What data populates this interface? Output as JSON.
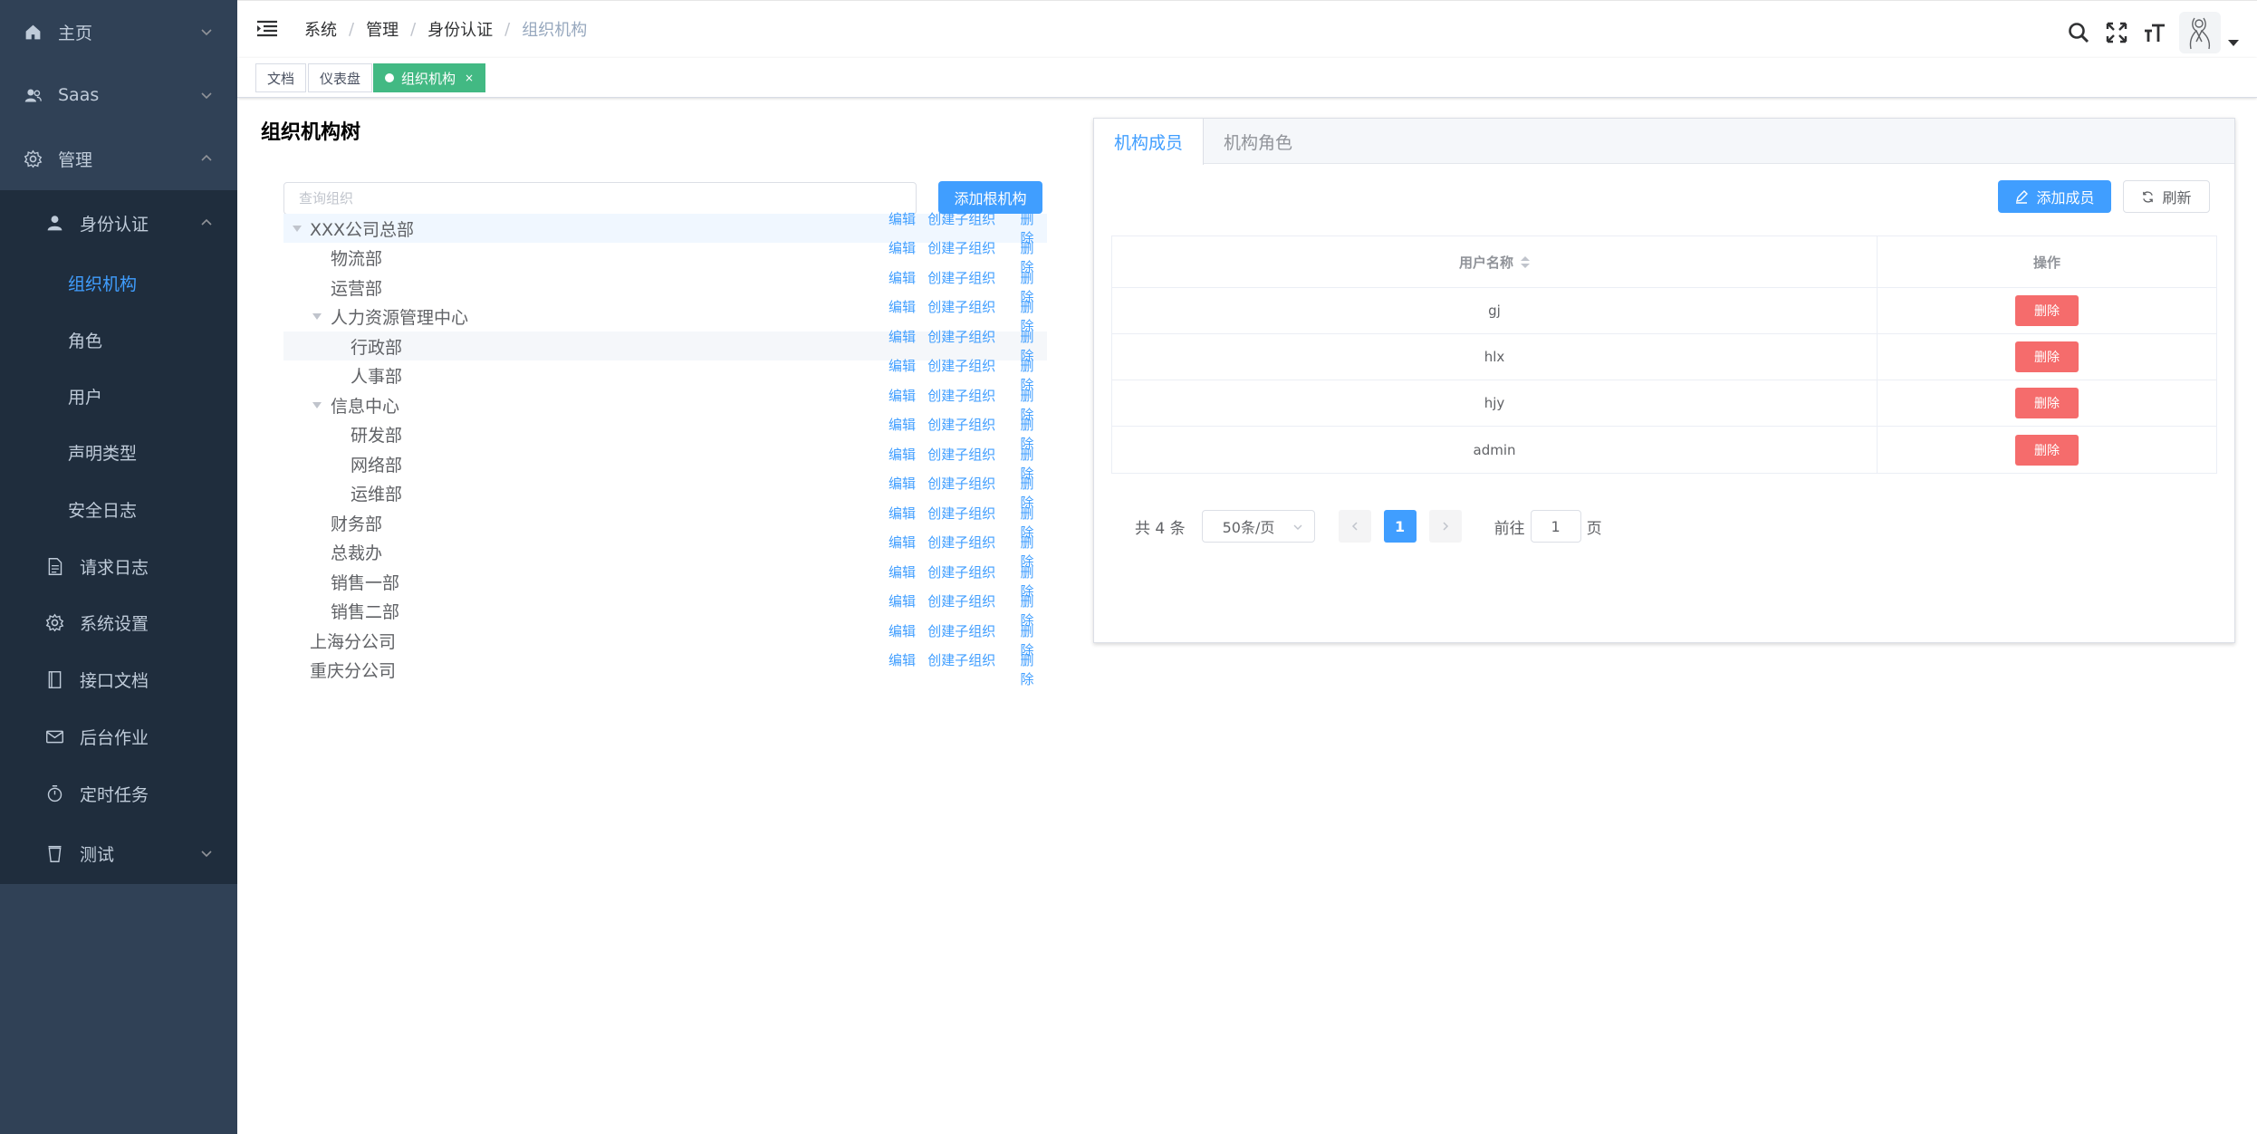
{
  "sidebar": {
    "items": [
      {
        "label": "主页",
        "icon": "home-icon"
      },
      {
        "label": "Saas",
        "icon": "users-icon"
      },
      {
        "label": "管理",
        "icon": "gear-icon"
      },
      {
        "label": "身份认证",
        "icon": "user-icon"
      },
      {
        "label": "组织机构"
      },
      {
        "label": "角色"
      },
      {
        "label": "用户"
      },
      {
        "label": "声明类型"
      },
      {
        "label": "安全日志"
      },
      {
        "label": "请求日志",
        "icon": "document-icon"
      },
      {
        "label": "系统设置",
        "icon": "gear-icon"
      },
      {
        "label": "接口文档",
        "icon": "notebook-icon"
      },
      {
        "label": "后台作业",
        "icon": "mail-icon"
      },
      {
        "label": "定时任务",
        "icon": "stopwatch-icon"
      },
      {
        "label": "测试",
        "icon": "cup-icon"
      }
    ],
    "active_color": "#409eff"
  },
  "header": {
    "breadcrumb": [
      "系统",
      "管理",
      "身份认证",
      "组织机构"
    ],
    "breadcrumb_separator": "/",
    "icons": [
      "search-icon",
      "fullscreen-icon",
      "font-size-icon"
    ]
  },
  "tags": [
    {
      "label": "文档"
    },
    {
      "label": "仪表盘"
    },
    {
      "label": "组织机构",
      "close": "×"
    }
  ],
  "tree": {
    "title": "组织机构树",
    "search_placeholder": "查询组织",
    "add_root_label": "添加根机构",
    "action_edit": "编辑",
    "action_add_child": "创建子组织",
    "action_delete": "删除",
    "nodes": [
      {
        "label": "XXX公司总部",
        "expanded": true
      },
      {
        "label": "物流部"
      },
      {
        "label": "运营部"
      },
      {
        "label": "人力资源管理中心",
        "expanded": true
      },
      {
        "label": "行政部"
      },
      {
        "label": "人事部"
      },
      {
        "label": "信息中心",
        "expanded": true
      },
      {
        "label": "研发部"
      },
      {
        "label": "网络部"
      },
      {
        "label": "运维部"
      },
      {
        "label": "财务部"
      },
      {
        "label": "总裁办"
      },
      {
        "label": "销售一部"
      },
      {
        "label": "销售二部"
      },
      {
        "label": "上海分公司"
      },
      {
        "label": "重庆分公司"
      }
    ]
  },
  "panel": {
    "tabs": [
      "机构成员",
      "机构角色"
    ],
    "add_member_label": "添加成员",
    "refresh_label": "刷新",
    "table": {
      "headers": [
        "用户名称",
        "操作"
      ],
      "rows": [
        {
          "name": "gj",
          "action": "删除"
        },
        {
          "name": "hlx",
          "action": "删除"
        },
        {
          "name": "hjy",
          "action": "删除"
        },
        {
          "name": "admin",
          "action": "删除"
        }
      ]
    },
    "pagination": {
      "total_text": "共 4 条",
      "page_size": "50条/页",
      "current_page": "1",
      "goto_prefix": "前往",
      "goto_value": "1",
      "goto_suffix": "页"
    }
  },
  "colors": {
    "primary": "#409eff",
    "danger": "#f56c6c",
    "tag_active": "#42b983",
    "sidebar_bg": "#304156",
    "submenu_bg": "#1f2d3d"
  }
}
